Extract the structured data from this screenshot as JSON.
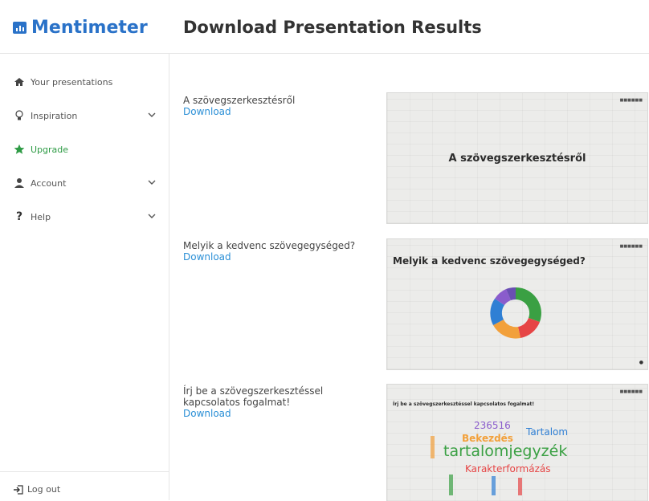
{
  "app": {
    "logo_text": "Mentimeter",
    "page_title": "Download Presentation Results"
  },
  "sidebar": {
    "items": [
      {
        "label": "Your presentations",
        "icon": "home-icon"
      },
      {
        "label": "Inspiration",
        "icon": "lightbulb-icon",
        "has_chevron": true
      },
      {
        "label": "Upgrade",
        "icon": "star-icon",
        "color": "#2e9b45"
      },
      {
        "label": "Account",
        "icon": "user-icon",
        "has_chevron": true
      },
      {
        "label": "Help",
        "icon": "question-icon",
        "has_chevron": true
      }
    ],
    "logout_label": "Log out"
  },
  "slides": [
    {
      "title": "A szövegszerkesztésről",
      "download_label": "Download",
      "slide_text": "A szövegszerkesztésről"
    },
    {
      "title": "Melyik a kedvenc szövegegységed?",
      "download_label": "Download",
      "slide_text": "Melyik a kedvenc szövegegységed?"
    },
    {
      "title": "Írj be a szövegszerkesztéssel kapcsolatos fogalmat!",
      "download_label": "Download",
      "slide_text": "Írj be a szövegszerkesztéssel kapcsolatos fogalmat!",
      "words": [
        "236516",
        "Tartalom",
        "Bekezdés",
        "tartalomjegyzék",
        "Karakterformázás"
      ]
    }
  ],
  "colors": {
    "accent": "#2a72c8",
    "link": "#2a8fd6",
    "upgrade": "#2e9b45"
  }
}
